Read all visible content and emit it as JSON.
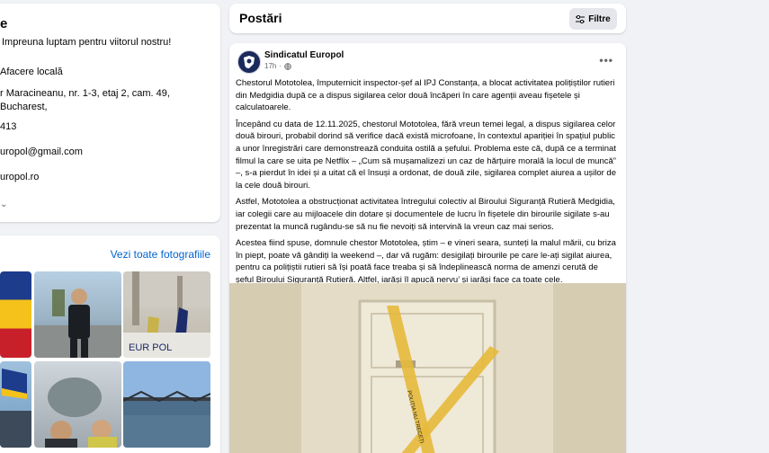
{
  "intro": {
    "title": "e",
    "slogan": "Impreuna luptam pentru viitorul nostru!",
    "category": "Afacere locală",
    "address": "r Maracineanu, nr. 1-3, etaj 2, cam. 49, Bucharest,",
    "phone": "413",
    "email": "uropol@gmail.com",
    "website": "uropol.ro"
  },
  "photos": {
    "see_all": "Vezi toate fotografiile",
    "europol_sign": "EUR  POL"
  },
  "posts_header": {
    "title": "Postări",
    "filter_label": "Filtre"
  },
  "post": {
    "author": "Sindicatul Europol",
    "time": "17h",
    "paragraphs": [
      "Chestorul Mototolea, împuternicit inspector-șef al IPJ Constanța, a blocat activitatea polițiștilor rutieri din Medgidia după ce a dispus sigilarea celor două încăperi în care agenții aveau fișetele și calculatoarele.",
      "Începând cu data de 12.11.2025, chestorul Mototolea, fără vreun temei legal, a dispus sigilarea celor două birouri, probabil dorind să verifice dacă există microfoane, în contextul apariției în spațiul public a unor înregistrări care demonstrează conduita ostilă a șefului. Problema este că, după ce a terminat filmul la care se uita pe Netflix – „Cum să mușamalizezi un caz de hărțuire morală la locul de muncă” –, s-a pierdut în idei și a uitat că el însuși a ordonat, de două zile, sigilarea complet aiurea a ușilor de la cele două birouri.",
      "Astfel, Mototolea a obstrucționat activitatea întregului colectiv al Biroului Siguranță Rutieră Medgidia, iar colegii care au mijloacele din dotare și documentele de lucru în fișetele din birourile sigilate s-au prezentat la muncă rugându-se să nu fie nevoiți să intervină la vreun caz mai serios.",
      "Acestea fiind spuse, domnule chestor Mototolea, știm – e vineri seara, sunteți la malul mării, cu briza în piept, poate vă gândiți la weekend –, dar vă rugăm: desigilați birourile pe care le-ați sigilat aiurea, pentru ca polițiștii rutieri să își poată face treaba și să îndeplinească norma de amenzi cerută de șeful Biroului Siguranță Rutieră. Altfel, iarăși îl apucă nervu’ și iarăși face ca toate cele."
    ],
    "tape_text": "POLIȚIA NU TRECEȚI"
  }
}
